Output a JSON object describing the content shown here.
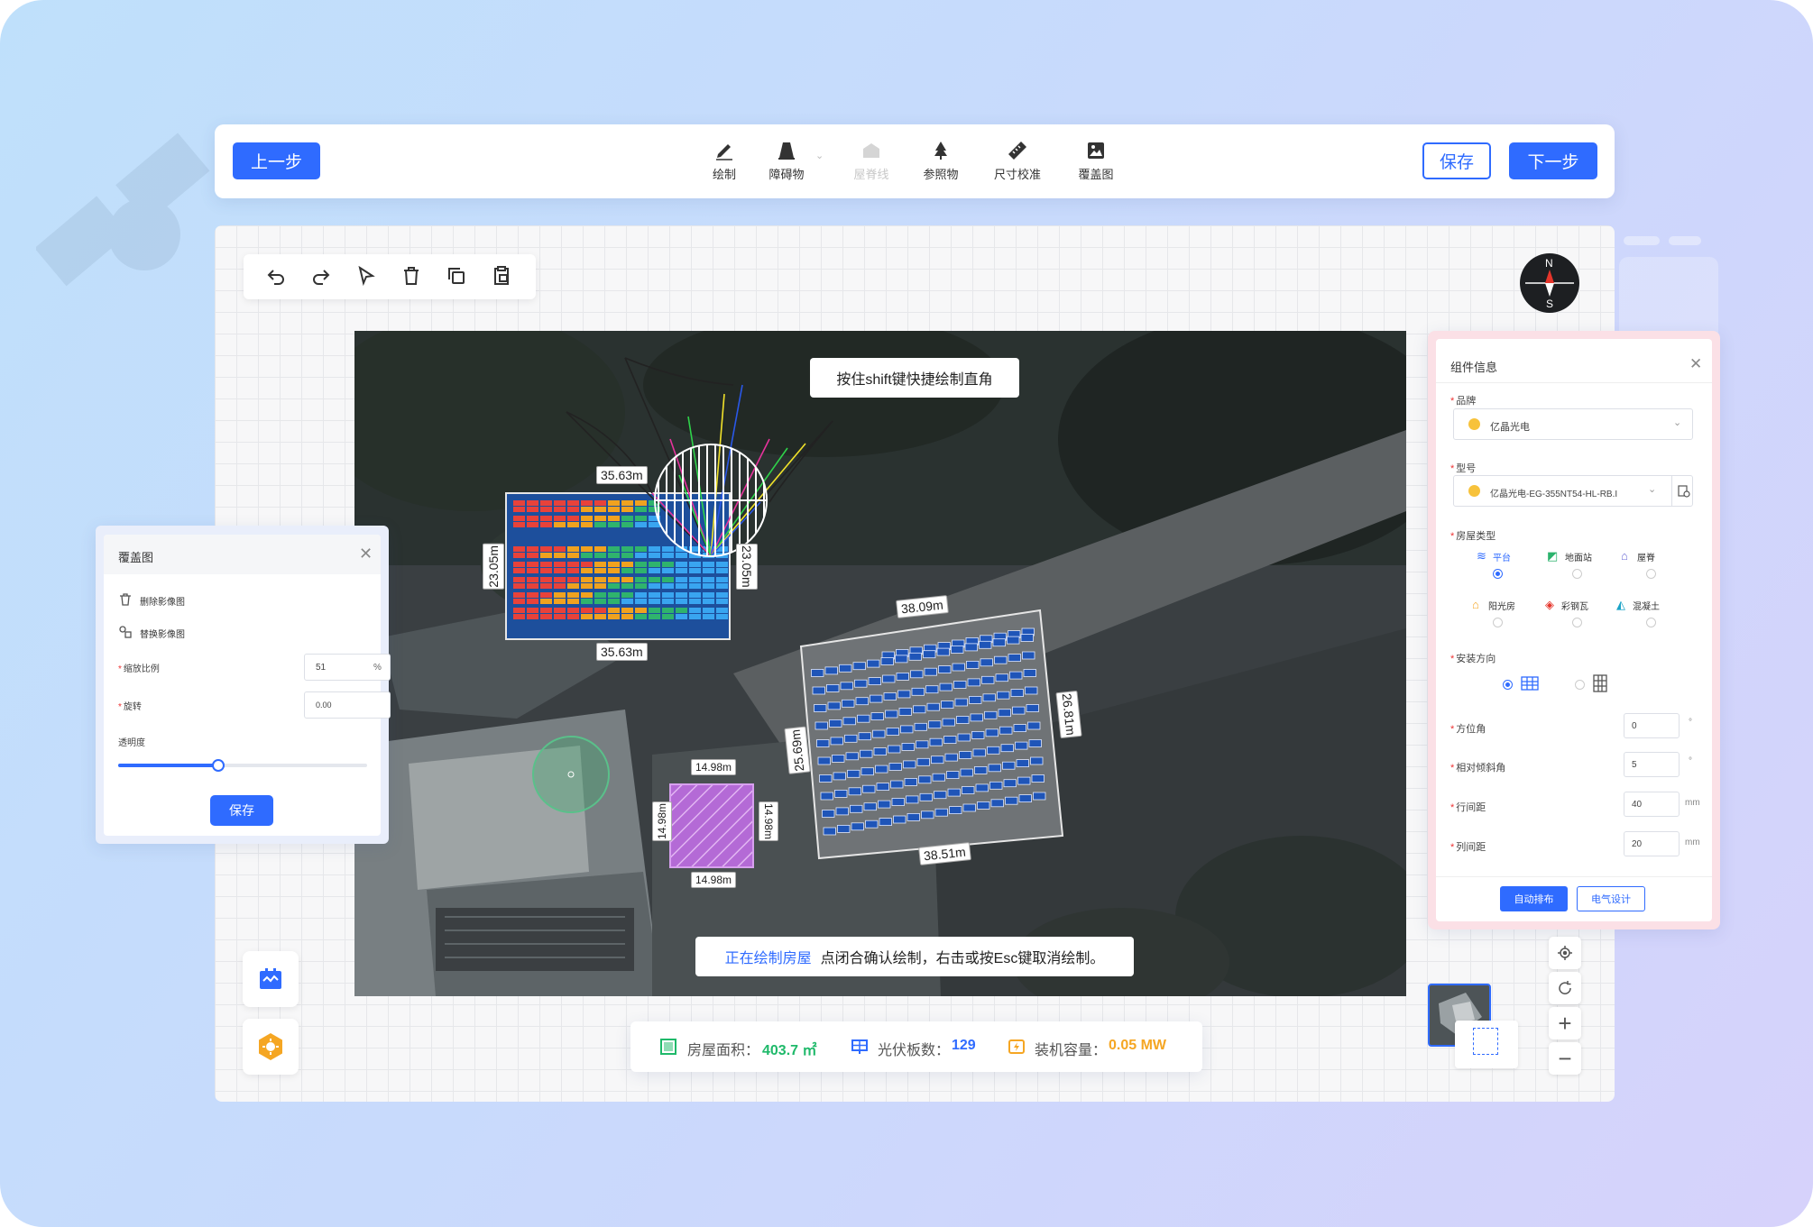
{
  "toolbar": {
    "prev_label": "上一步",
    "save_label": "保存",
    "next_label": "下一步",
    "tools": [
      {
        "label": "绘制",
        "icon": "pen-icon"
      },
      {
        "label": "障碍物",
        "icon": "obstacle-icon"
      },
      {
        "label": "屋脊线",
        "icon": "ridge-line-icon"
      },
      {
        "label": "参照物",
        "icon": "tree-icon"
      },
      {
        "label": "尺寸校准",
        "icon": "ruler-icon"
      },
      {
        "label": "覆盖图",
        "icon": "overlay-image-icon"
      }
    ]
  },
  "compass": {
    "north": "N",
    "south": "S"
  },
  "map": {
    "hint": "按住shift键快捷绘制直角",
    "status_highlight": "正在绘制房屋",
    "status_text": "点闭合确认绘制，右击或按Esc键取消绘制。",
    "dims": {
      "roof1_top": "35.63m",
      "roof1_bottom": "35.63m",
      "roof1_left": "23.05m",
      "roof1_right": "23.05m",
      "roof2_top": "38.09m",
      "roof2_bottom": "38.51m",
      "roof2_left": "25.69m",
      "roof2_right": "26.81m",
      "sq_top": "14.98m",
      "sq_bottom": "14.98m",
      "sq_left": "14.98m",
      "sq_right": "14.98m"
    }
  },
  "overlay_panel": {
    "title": "覆盖图",
    "delete_label": "删除影像图",
    "replace_label": "替换影像图",
    "scale_label": "缩放比例",
    "scale_value": "51",
    "scale_unit": "%",
    "rotate_label": "旋转",
    "rotate_value": "0.00",
    "opacity_label": "透明度",
    "opacity_value": 0.4,
    "save_label": "保存"
  },
  "component_panel": {
    "title": "组件信息",
    "brand_label": "品牌",
    "brand_value": "亿晶光电",
    "model_label": "型号",
    "model_value": "亿晶光电-EG-355NT54-HL-RB.I",
    "roof_type_label": "房屋类型",
    "roof_types": [
      "平台",
      "地面站",
      "屋脊",
      "阳光房",
      "彩钢瓦",
      "混凝土"
    ],
    "roof_type_selected": "平台",
    "install_dir_label": "安装方向",
    "azimuth_label": "方位角",
    "azimuth_value": "0",
    "azimuth_unit": "°",
    "tilt_label": "相对倾斜角",
    "tilt_value": "5",
    "tilt_unit": "°",
    "row_gap_label": "行间距",
    "row_gap_value": "40",
    "row_gap_unit": "mm",
    "col_gap_label": "列间距",
    "col_gap_value": "20",
    "col_gap_unit": "mm",
    "auto_layout_label": "自动排布",
    "electrical_label": "电气设计"
  },
  "stats": {
    "area_label": "房屋面积：",
    "area_value": "403.7 ㎡",
    "panels_label": "光伏板数：",
    "panels_value": "129",
    "capacity_label": "装机容量：",
    "capacity_value": "0.05 MW"
  },
  "colors": {
    "primary": "#2f6bff",
    "area": "#1fb96a",
    "panels": "#2f6bff",
    "capacity": "#f5a623"
  }
}
